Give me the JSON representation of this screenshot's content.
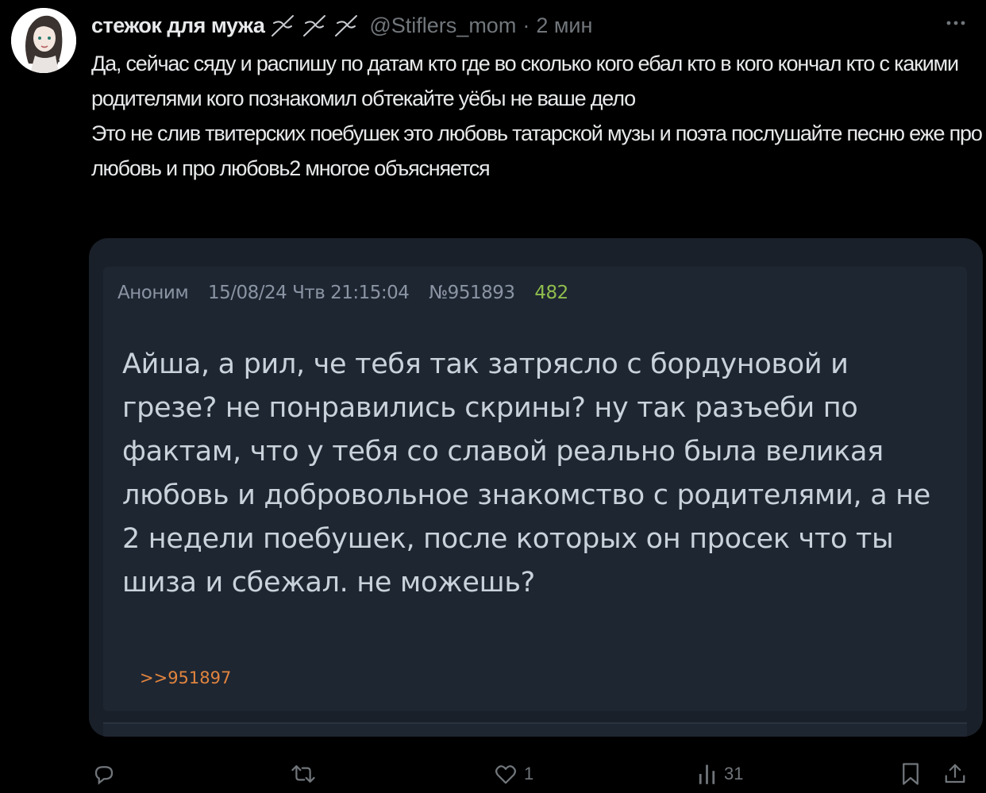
{
  "author": {
    "display_name": "стежок для мужа",
    "handle": "@Stiflers_mom",
    "separator": "·",
    "time": "2 мин",
    "more_label": "More",
    "name_emoji": "needle-emoji"
  },
  "tweet": {
    "text": "Да, сейчас сяду и распишу по датам кто где во сколько кого ебал кто в кого кончал кто с какими родителями кого познакомил обтекайте уёбы не ваше дело\nЭто не слив твитерских поебушек это любовь татарской музы и поэта послушайте песню еже про любовь и про любовь2 многое объясняется"
  },
  "embedded_post": {
    "author": "Аноним",
    "date": "15/08/24 Чтв 21:15:04",
    "number": "№951893",
    "replies": "482",
    "body": "Айша, а рил, че тебя так затрясло с бордуновой и грезе? не понравились скрины? ну так разъеби по фактам, что у тебя со славой реально была великая любовь и добровольное знакомство с родителями, а не 2 недели поебушек, после которых он просек что ты шиза и сбежал. не можешь?",
    "reply_link": ">>951897"
  },
  "actions": {
    "reply_count": "",
    "retweet_count": "",
    "like_count": "1",
    "views_count": "31"
  },
  "colors": {
    "background": "#000000",
    "text": "#e7e9ea",
    "secondary": "#71767b",
    "post_background": "#1e2632",
    "post_link": "#e0843e",
    "post_replies": "#8fbd4d"
  },
  "icons": [
    "reply-icon",
    "retweet-icon",
    "like-icon",
    "views-icon",
    "bookmark-icon",
    "share-icon",
    "more-icon"
  ]
}
